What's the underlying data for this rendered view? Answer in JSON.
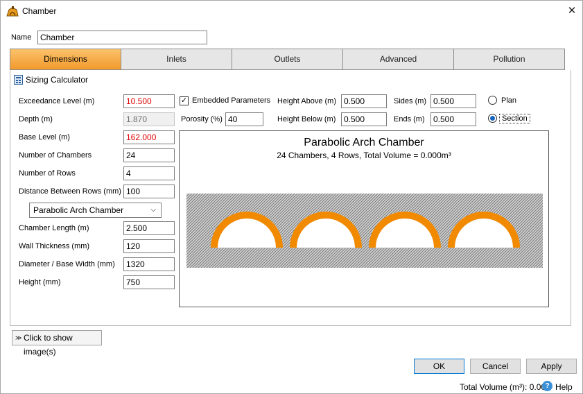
{
  "window": {
    "title": "Chamber",
    "close_glyph": "✕"
  },
  "name_field": {
    "label": "Name",
    "value": "Chamber"
  },
  "tabs": [
    {
      "label": "Dimensions",
      "active": true
    },
    {
      "label": "Inlets",
      "active": false
    },
    {
      "label": "Outlets",
      "active": false
    },
    {
      "label": "Advanced",
      "active": false
    },
    {
      "label": "Pollution",
      "active": false
    }
  ],
  "sizing_calculator": {
    "label": "Sizing Calculator",
    "icon": "calculator-icon"
  },
  "fields": {
    "exceedance_level": {
      "label": "Exceedance Level (m)",
      "value": "10.500"
    },
    "depth": {
      "label": "Depth (m)",
      "value": "1.870"
    },
    "base_level": {
      "label": "Base Level (m)",
      "value": "162.000"
    },
    "number_of_chambers": {
      "label": "Number of Chambers",
      "value": "24"
    },
    "number_of_rows": {
      "label": "Number of Rows",
      "value": "4"
    },
    "distance_between_rows": {
      "label": "Distance Between Rows (mm)",
      "value": "100"
    },
    "chamber_type": {
      "value": "Parabolic Arch Chamber"
    },
    "chamber_length": {
      "label": "Chamber Length (m)",
      "value": "2.500"
    },
    "wall_thickness": {
      "label": "Wall Thickness (mm)",
      "value": "120"
    },
    "diameter_base_width": {
      "label": "Diameter / Base Width (mm)",
      "value": "1320"
    },
    "height": {
      "label": "Height (mm)",
      "value": "750"
    }
  },
  "embedded": {
    "label": "Embedded Parameters",
    "checked": true,
    "check_glyph": "✓"
  },
  "porosity": {
    "label": "Porosity (%)",
    "value": "40"
  },
  "height_above": {
    "label": "Height Above (m)",
    "value": "0.500"
  },
  "height_below": {
    "label": "Height Below (m)",
    "value": "0.500"
  },
  "sides": {
    "label": "Sides (m)",
    "value": "0.500"
  },
  "ends": {
    "label": "Ends (m)",
    "value": "0.500"
  },
  "view_mode": {
    "plan_label": "Plan",
    "section_label": "Section",
    "selected": "Section"
  },
  "preview": {
    "title": "Parabolic Arch Chamber",
    "subtitle": "24 Chambers, 4 Rows, Total Volume = 0.000m³",
    "arch_count": 4,
    "arch_color": "#f28a00",
    "fill_color": "#b9b9b9"
  },
  "show_images_button": {
    "label": "Click to show image(s)",
    "glyph": "≫"
  },
  "buttons": {
    "ok": "OK",
    "cancel": "Cancel",
    "apply": "Apply"
  },
  "status_bar": {
    "total_volume": "Total Volume (m³): 0.000",
    "help": "Help",
    "help_glyph": "?"
  },
  "colors": {
    "accent_tab": "#f5a844",
    "error_text": "#e00000",
    "radio_accent": "#1565c0"
  }
}
